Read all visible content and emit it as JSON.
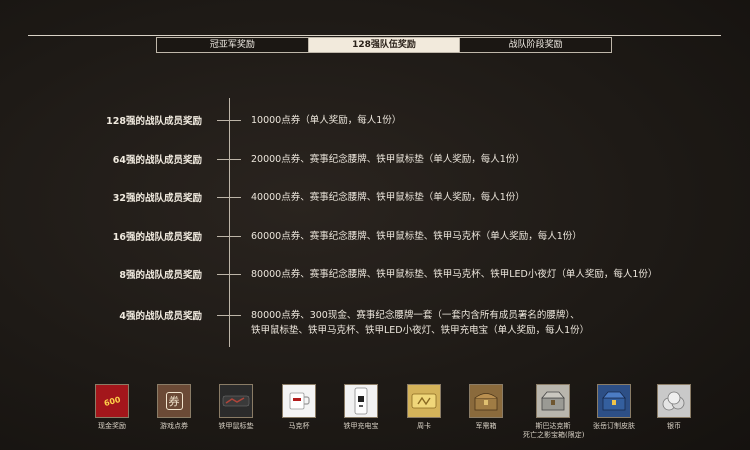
{
  "tabs": [
    {
      "label": "冠亚军奖励",
      "active": false
    },
    {
      "label": "128强队伍奖励",
      "active": true
    },
    {
      "label": "战队阶段奖励",
      "active": false
    }
  ],
  "rewards": [
    {
      "label": "128强的战队成员奖励",
      "reward": "10000点券（单人奖励，每人1份）"
    },
    {
      "label": "64强的战队成员奖励",
      "reward": "20000点券、赛事纪念腰牌、铁甲鼠标垫（单人奖励，每人1份）"
    },
    {
      "label": "32强的战队成员奖励",
      "reward": "40000点券、赛事纪念腰牌、铁甲鼠标垫（单人奖励，每人1份）"
    },
    {
      "label": "16强的战队成员奖励",
      "reward": "60000点券、赛事纪念腰牌、铁甲鼠标垫、铁甲马克杯（单人奖励，每人1份）"
    },
    {
      "label": "8强的战队成员奖励",
      "reward": "80000点券、赛事纪念腰牌、铁甲鼠标垫、铁甲马克杯、铁甲LED小夜灯（单人奖励，每人1份）"
    },
    {
      "label": "4强的战队成员奖励",
      "reward": "80000点券、300现金、赛事纪念腰牌一套（一套内含所有成员署名的腰牌）、",
      "reward_line2": "铁甲鼠标垫、铁甲马克杯、铁甲LED小夜灯、铁甲充电宝（单人奖励，每人1份）"
    }
  ],
  "items": [
    {
      "caption": "现金奖励",
      "icon": "cash-envelope-icon",
      "color": "#a3161b",
      "badge": "600"
    },
    {
      "caption": "游戏点券",
      "icon": "voucher-icon",
      "color": "#6b4a36",
      "badge": "券"
    },
    {
      "caption": "铁甲鼠标垫",
      "icon": "mousepad-icon",
      "color": "#2b2b2b",
      "badge": ""
    },
    {
      "caption": "马克杯",
      "icon": "mug-icon",
      "color": "#f4f4f4",
      "badge": ""
    },
    {
      "caption": "铁甲充电宝",
      "icon": "power-bank-icon",
      "color": "#f2f2f2",
      "badge": ""
    },
    {
      "caption": "周卡",
      "icon": "week-card-icon",
      "color": "#d4b35a",
      "badge": ""
    },
    {
      "caption": "军需箱",
      "icon": "supply-box-icon",
      "color": "#8a6a3c",
      "badge": ""
    },
    {
      "caption": "斯巴达克斯",
      "caption2": "死亡之影宝箱(限定)",
      "icon": "treasure-chest-icon",
      "color": "#b9b6ad",
      "badge": ""
    },
    {
      "caption": "张岳订制皮肤",
      "icon": "skin-chest-icon",
      "color": "#2d4f86",
      "badge": ""
    },
    {
      "caption": "银币",
      "icon": "silver-coins-icon",
      "color": "#c9c9c9",
      "badge": ""
    }
  ]
}
